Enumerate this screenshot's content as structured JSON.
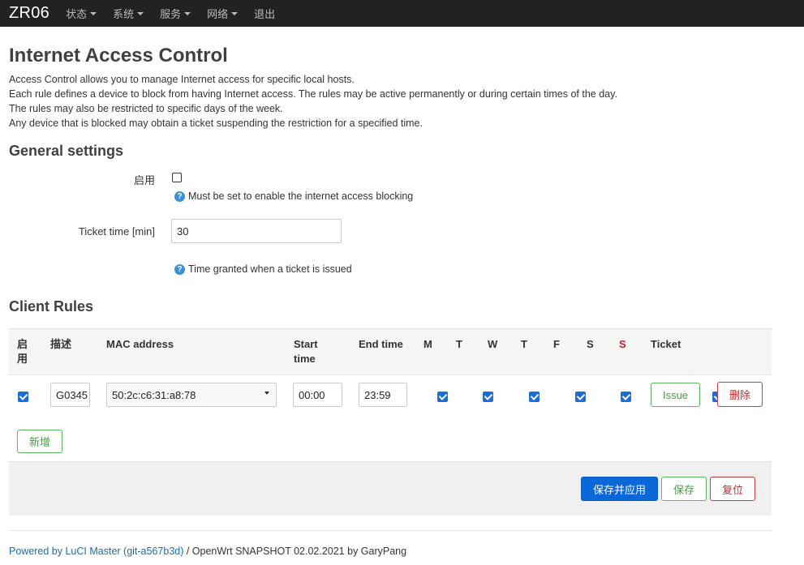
{
  "navbar": {
    "brand": "ZR06",
    "menu": [
      {
        "label": "状态",
        "dropdown": true
      },
      {
        "label": "系统",
        "dropdown": true
      },
      {
        "label": "服务",
        "dropdown": true
      },
      {
        "label": "网络",
        "dropdown": true
      },
      {
        "label": "退出",
        "dropdown": false
      }
    ]
  },
  "page": {
    "title": "Internet Access Control",
    "description": [
      "Access Control allows you to manage Internet access for specific local hosts.",
      "Each rule defines a device to block from having Internet access. The rules may be active permanently or during certain times of the day.",
      "The rules may also be restricted to specific days of the week.",
      "Any device that is blocked may obtain a ticket suspending the restriction for a specified time."
    ]
  },
  "general": {
    "title": "General settings",
    "enable_label": "启用",
    "enable_checked": false,
    "enable_help": "Must be set to enable the internet access blocking",
    "ticket_label": "Ticket time [min]",
    "ticket_value": "30",
    "ticket_help": "Time granted when a ticket is issued",
    "help_icon_glyph": "?"
  },
  "rules": {
    "title": "Client Rules",
    "headers": {
      "enable": "启\n用",
      "desc": "描述",
      "mac": "MAC address",
      "start": "Start\ntime",
      "end": "End time",
      "mon": "M",
      "tue": "T",
      "wed": "W",
      "thu": "T",
      "fri": "F",
      "sat": "S",
      "sun": "S",
      "ticket": "Ticket"
    },
    "row": {
      "enabled": true,
      "desc": "G0345",
      "mac": "50:2c:c6:31:a8:78",
      "start": "00:00",
      "end": "23:59",
      "days": [
        true,
        true,
        true,
        true,
        true,
        true,
        true
      ],
      "issue_label": "Issue",
      "delete_label": "删除"
    },
    "add_label": "新增"
  },
  "actions": {
    "save_apply": "保存并应用",
    "save": "保存",
    "reset": "复位"
  },
  "footer": {
    "link": "Powered by LuCI Master (git-a567b3d)",
    "text": " / OpenWrt SNAPSHOT 02.02.2021 by GaryPang"
  },
  "colors": {
    "navbar_bg": "#222222",
    "primary": "#0a68d8",
    "checkbox_checked": "#1a6ed8",
    "sunday": "#c02020"
  }
}
